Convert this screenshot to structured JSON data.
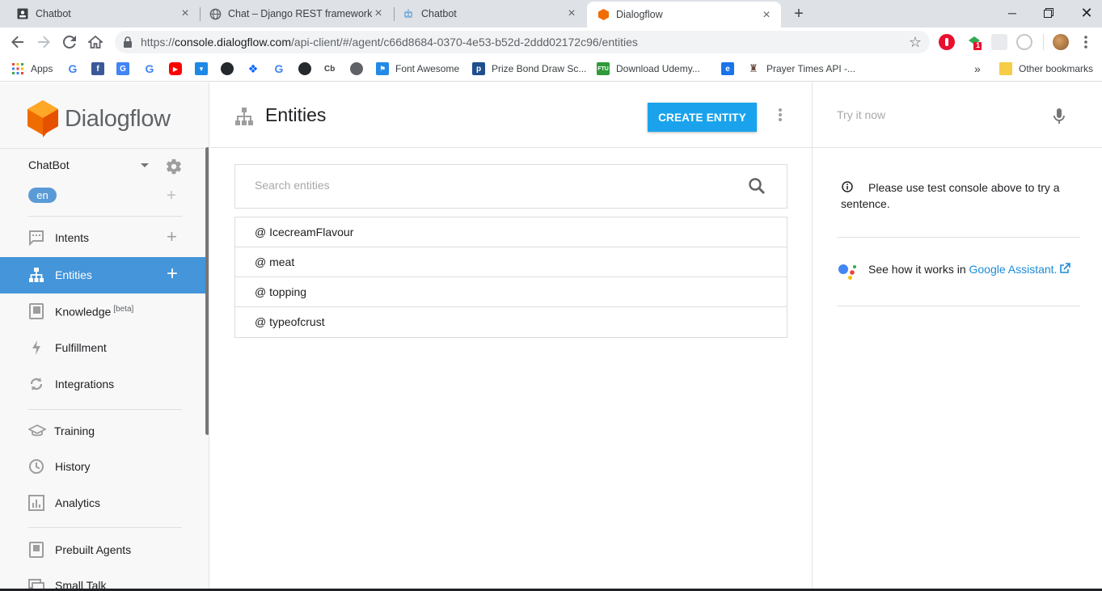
{
  "browser": {
    "tabs": [
      {
        "title": "Chatbot",
        "icon": "document-icon"
      },
      {
        "title": "Chat – Django REST framework",
        "icon": "globe-icon"
      },
      {
        "title": "Chatbot",
        "icon": "robot-icon"
      },
      {
        "title": "Dialogflow",
        "icon": "dialogflow-icon",
        "active": true
      }
    ],
    "url_prefix": "https://",
    "url_host": "console.dialogflow.com",
    "url_path": "/api-client/#/agent/c66d8684-0370-4e53-b52d-2ddd02172c96/entities",
    "extension_badge": "1",
    "bookmarks": [
      {
        "label": "Apps",
        "icon": "apps-grid-icon"
      },
      {
        "label": "",
        "icon": "google-icon"
      },
      {
        "label": "",
        "icon": "facebook-icon"
      },
      {
        "label": "",
        "icon": "google-translate-icon"
      },
      {
        "label": "",
        "icon": "google-icon"
      },
      {
        "label": "",
        "icon": "youtube-icon"
      },
      {
        "label": "",
        "icon": "pocket-icon"
      },
      {
        "label": "",
        "icon": "github-icon"
      },
      {
        "label": "",
        "icon": "dropbox-icon"
      },
      {
        "label": "",
        "icon": "google-icon"
      },
      {
        "label": "",
        "icon": "github-icon"
      },
      {
        "label": "Cb",
        "icon": "cb-icon"
      },
      {
        "label": "",
        "icon": "globe-icon"
      },
      {
        "label": "Font Awesome",
        "icon": "font-awesome-flag-icon"
      },
      {
        "label": "Prize Bond Draw Sc...",
        "icon": "p-icon"
      },
      {
        "label": "Download Udemy...",
        "icon": "ftu-icon"
      },
      {
        "label": "",
        "icon": "e-icon"
      },
      {
        "label": "Prayer Times API -...",
        "icon": "mosque-icon"
      }
    ],
    "bookmarks_overflow": "»",
    "other_bookmarks": "Other bookmarks"
  },
  "app": {
    "logo_text": "Dialogflow",
    "agent_name": "ChatBot",
    "language": "en",
    "nav_primary": [
      {
        "label": "Intents",
        "icon": "intents-icon",
        "add": true
      },
      {
        "label": "Entities",
        "icon": "entities-icon",
        "add": true,
        "active": true
      },
      {
        "label": "Knowledge",
        "sup": "[beta]",
        "icon": "knowledge-icon"
      },
      {
        "label": "Fulfillment",
        "icon": "lightning-icon"
      },
      {
        "label": "Integrations",
        "icon": "integrations-icon"
      }
    ],
    "nav_secondary": [
      {
        "label": "Training",
        "icon": "training-icon"
      },
      {
        "label": "History",
        "icon": "history-icon"
      },
      {
        "label": "Analytics",
        "icon": "analytics-icon"
      }
    ],
    "nav_tertiary": [
      {
        "label": "Prebuilt Agents",
        "icon": "prebuilt-agents-icon"
      },
      {
        "label": "Small Talk",
        "icon": "small-talk-icon"
      }
    ]
  },
  "main": {
    "title": "Entities",
    "create_button": "CREATE ENTITY",
    "search_placeholder": "Search entities",
    "entities": [
      "@ IcecreamFlavour",
      "@ meat",
      "@ topping",
      "@ typeofcrust"
    ]
  },
  "console": {
    "try_placeholder": "Try it now",
    "info_text": "Please use test console above to try a sentence.",
    "assistant_prefix": "See how it works in ",
    "assistant_link": "Google Assistant."
  },
  "colors": {
    "accent": "#1aa3ec",
    "active_nav": "#4495d9",
    "logo_orange": "#ef6c00",
    "link": "#1a8cd8"
  }
}
